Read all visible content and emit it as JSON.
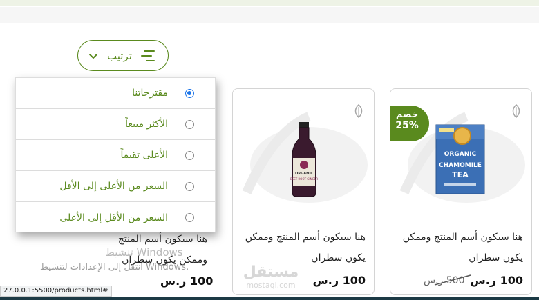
{
  "sort": {
    "label": "ترتيب"
  },
  "sort_menu": {
    "options": [
      {
        "label": "مقترحاتنا",
        "selected": true
      },
      {
        "label": "الأكثر مبيعاً",
        "selected": false
      },
      {
        "label": "الأعلى تقيماً",
        "selected": false
      },
      {
        "label": "السعر من الأعلى إلى الأقل",
        "selected": false
      },
      {
        "label": "السعر من الأقل إلى الأعلى",
        "selected": false
      }
    ]
  },
  "products": [
    {
      "title": "هنا سيكون أسم المنتج وممكن يكون سطران",
      "price": "100 ر.س",
      "old_price": "500 ر.س",
      "badge_line1": "خصم",
      "badge_line2": "25%",
      "image_icon": "chamomile-tea-box",
      "tea_brand": "ORGANIC",
      "tea_name": "CHAMOMILE TEA"
    },
    {
      "title": "هنا سيكون أسم المنتج وممكن يكون سطران",
      "price": "100 ر.س",
      "image_icon": "beetroot-juice-bottle",
      "bottle_label1": "ORGANIC",
      "bottle_label2": "BEET ROOT GINGER"
    },
    {
      "title": "هنا سيكون أسم المنتج وممكن يكون سطران",
      "price": "100 ر.س"
    }
  ],
  "windows_watermark": {
    "line1": "تنشيط Windows",
    "line2": "انتقل إلى الإعدادات لتنشيط Windows."
  },
  "status_url": "27.0.0.1:5500/products.html#",
  "mostaql": {
    "ar": "مستقل",
    "en": "mostaql.com"
  },
  "colors": {
    "accent": "#5a8a1e",
    "radio_selected": "#1a73e8"
  }
}
